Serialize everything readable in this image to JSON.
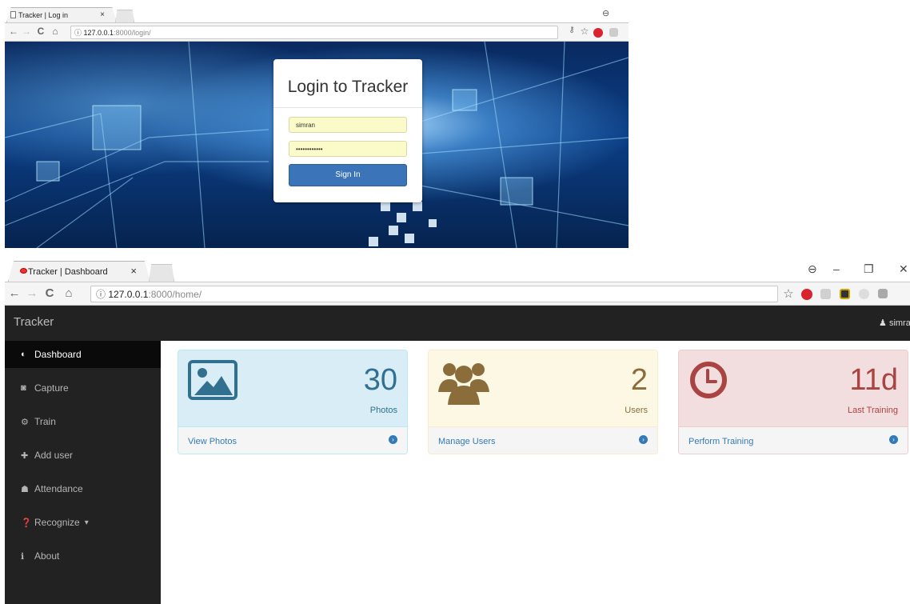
{
  "login_window": {
    "tab_title": "Tracker | Log in",
    "tab_close": "×",
    "url": {
      "info": "ⓘ",
      "host": "127.0.0.1",
      "path": ":8000/login/"
    },
    "form": {
      "heading": "Login to Tracker",
      "username_value": "simran",
      "password_value": "••••••••••••",
      "submit_label": "Sign In"
    }
  },
  "dashboard_window": {
    "tab_title": "Tracker | Dashboard",
    "tab_close": "×",
    "window_controls": {
      "minimize": "–",
      "restore": "❐",
      "close": "✕"
    },
    "url": {
      "info": "ⓘ",
      "host": "127.0.0.1",
      "path": ":8000/home/"
    },
    "navbar": {
      "brand": "Tracker",
      "user": "simra"
    },
    "sidebar": {
      "items": [
        {
          "label": "Dashboard",
          "icon": "dashboard-icon",
          "glyph": "◐",
          "active": true
        },
        {
          "label": "Capture",
          "icon": "camera-icon",
          "glyph": "◙",
          "active": false
        },
        {
          "label": "Train",
          "icon": "cogs-icon",
          "glyph": "⚙",
          "active": false
        },
        {
          "label": "Add user",
          "icon": "user-plus-icon",
          "glyph": "✚",
          "active": false
        },
        {
          "label": "Attendance",
          "icon": "users-icon",
          "glyph": "☗",
          "active": false
        },
        {
          "label": "Recognize",
          "icon": "question-circle-icon",
          "glyph": "❓",
          "caret": "▾",
          "active": false
        },
        {
          "label": "About",
          "icon": "info-icon",
          "glyph": "ℹ",
          "active": false
        }
      ]
    },
    "cards": [
      {
        "count": "30",
        "label": "Photos",
        "link": "View Photos",
        "icon": "image-icon",
        "colors": {
          "bg": "#d9edf7",
          "border": "#bce8f1",
          "text": "#31708f"
        }
      },
      {
        "count": "2",
        "label": "Users",
        "link": "Manage Users",
        "icon": "users-icon",
        "colors": {
          "bg": "#fcf8e3",
          "border": "#faebcc",
          "text": "#8a6d3b"
        }
      },
      {
        "count": "11d",
        "label": "Last Training",
        "link": "Perform Training",
        "icon": "clock-icon",
        "colors": {
          "bg": "#f2dede",
          "border": "#ebccd1",
          "text": "#a94442"
        }
      }
    ],
    "link_color": "#337ab7"
  }
}
